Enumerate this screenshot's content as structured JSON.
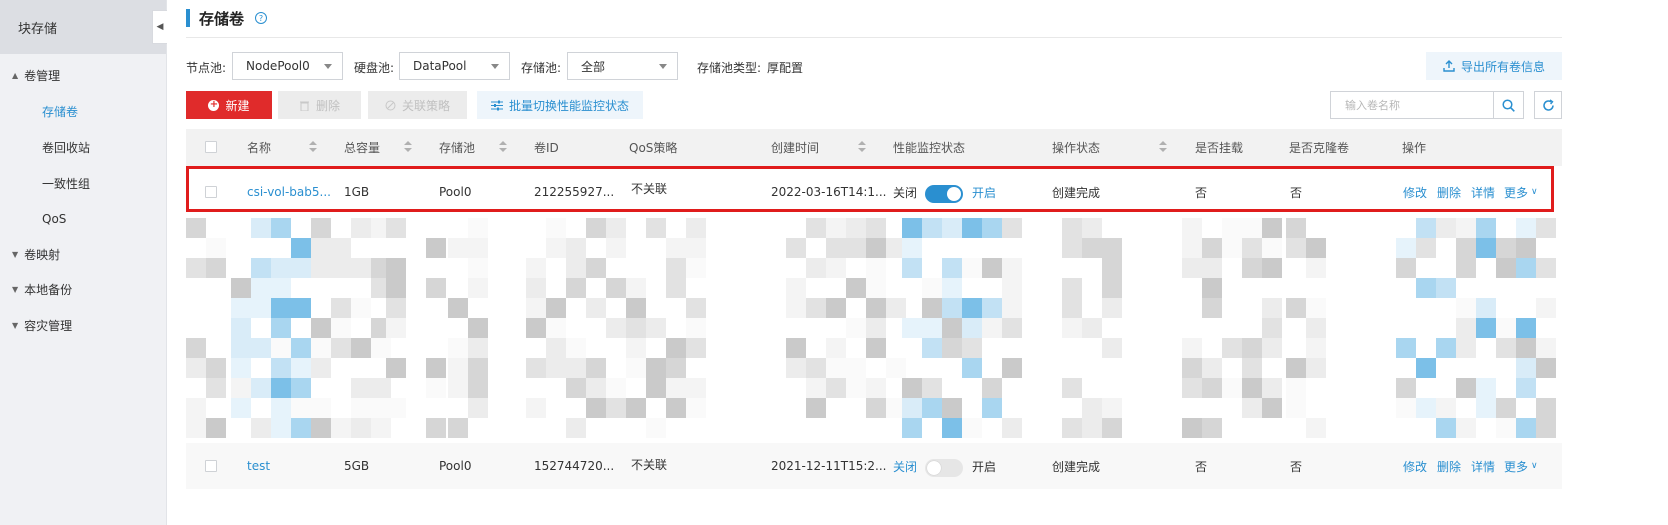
{
  "sidebar": {
    "header": "块存储",
    "groups": [
      {
        "label": "卷管理",
        "expanded": true
      },
      {
        "label": "卷映射",
        "expanded": false
      },
      {
        "label": "本地备份",
        "expanded": false
      },
      {
        "label": "容灾管理",
        "expanded": false
      }
    ],
    "items": [
      {
        "label": "存储卷",
        "active": true
      },
      {
        "label": "卷回收站"
      },
      {
        "label": "一致性组"
      },
      {
        "label": "QoS"
      }
    ]
  },
  "header": {
    "title": "存储卷",
    "help_icon": "question-circle-icon"
  },
  "filters": {
    "node_pool_label": "节点池:",
    "node_pool_value": "NodePool0",
    "disk_pool_label": "硬盘池:",
    "disk_pool_value": "DataPool",
    "storage_pool_label": "存储池:",
    "storage_pool_value": "全部",
    "pool_type_label": "存储池类型:",
    "pool_type_value": "厚配置"
  },
  "toolbar": {
    "export_label": "导出所有卷信息",
    "new_label": "新建",
    "delete_label": "删除",
    "unlink_policy_label": "关联策略",
    "batch_label": "批量切换性能监控状态",
    "search_placeholder": "输入卷名称"
  },
  "table": {
    "columns": [
      "名称",
      "总容量",
      "存储池",
      "卷ID",
      "QoS策略",
      "创建时间",
      "性能监控状态",
      "操作状态",
      "是否挂载",
      "是否克隆卷",
      "操作"
    ],
    "rows": [
      {
        "name": "csi-vol-bab5...",
        "capacity": "1GB",
        "pool": "Pool0",
        "id": "212255927...",
        "qos": "不关联",
        "created": "2022-03-16T14:1...",
        "monitor_off": "关闭",
        "monitor_on": "开启",
        "monitor_enabled": true,
        "status": "创建完成",
        "mounted": "否",
        "clone": "否",
        "actions": [
          "修改",
          "删除",
          "详情",
          "更多"
        ],
        "highlighted": true
      },
      {
        "name": "test",
        "capacity": "5GB",
        "pool": "Pool0",
        "id": "152744720...",
        "qos": "不关联",
        "created": "2021-12-11T15:2...",
        "monitor_off": "关闭",
        "monitor_on": "开启",
        "monitor_enabled": false,
        "status": "创建完成",
        "mounted": "否",
        "clone": "否",
        "actions": [
          "修改",
          "删除",
          "详情",
          "更多"
        ],
        "highlighted": false
      }
    ]
  },
  "colors": {
    "accent": "#2a8fd0",
    "danger": "#e02b2b",
    "highlight_border": "#e01c1c"
  }
}
